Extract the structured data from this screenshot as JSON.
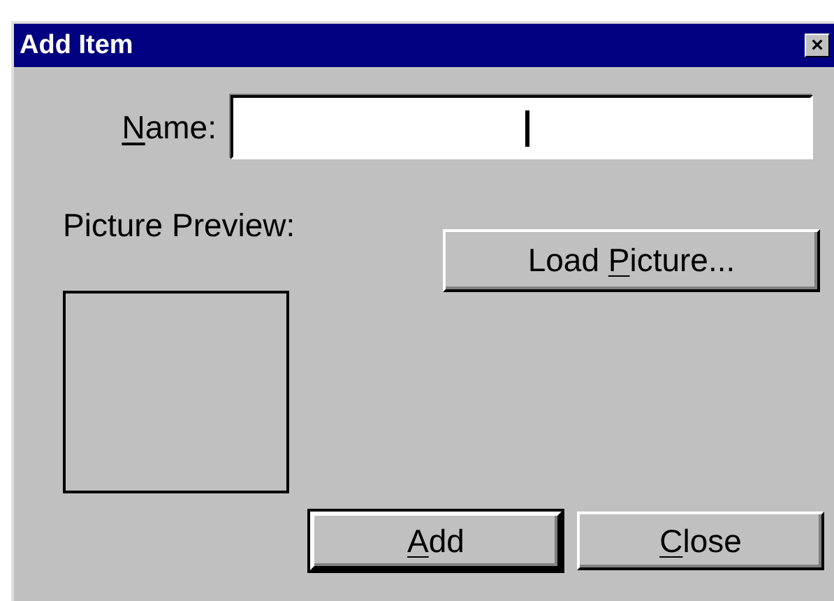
{
  "window": {
    "title": "Add Item",
    "close_symbol": "×"
  },
  "name_field": {
    "label": {
      "key": "N",
      "post": "ame:"
    },
    "focused": true
  },
  "preview": {
    "label": "Picture Preview:"
  },
  "buttons": [
    {
      "kind": "load",
      "pre": "Load ",
      "key": "P",
      "post": "icture...",
      "default": false
    },
    {
      "kind": "add",
      "key": "A",
      "post": "dd",
      "default": true
    },
    {
      "kind": "close",
      "key": "C",
      "post": "lose",
      "default": false
    }
  ]
}
